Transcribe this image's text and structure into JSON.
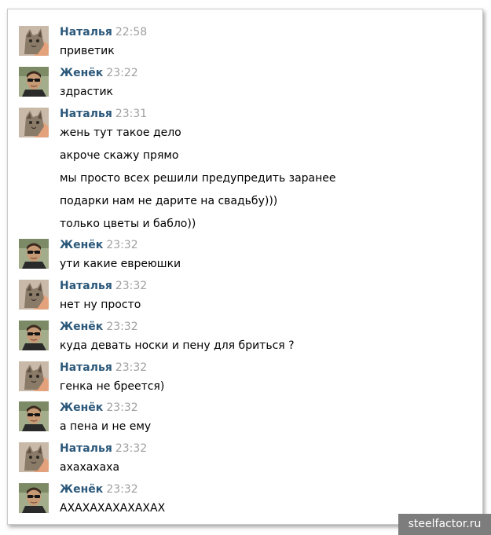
{
  "colors": {
    "author": "#2b587a",
    "time": "#a0a0a0",
    "text": "#000000"
  },
  "messages": [
    {
      "author": "Наталья",
      "time": "22:58",
      "avatar": "cat-avatar",
      "lines": [
        "приветик"
      ]
    },
    {
      "author": "Женёк",
      "time": "23:22",
      "avatar": "man-sunglasses-avatar",
      "lines": [
        "здрастик"
      ]
    },
    {
      "author": "Наталья",
      "time": "23:31",
      "avatar": "cat-avatar",
      "lines": [
        "жень тут такое дело",
        "акроче скажу прямо",
        "мы просто всех решили предупредить заранее",
        "подарки нам не дарите на свадьбу)))",
        "только цветы и бабло))"
      ]
    },
    {
      "author": "Женёк",
      "time": "23:32",
      "avatar": "man-sunglasses-avatar",
      "lines": [
        "ути какие евреюшки"
      ]
    },
    {
      "author": "Наталья",
      "time": "23:32",
      "avatar": "cat-avatar",
      "lines": [
        "нет ну просто"
      ]
    },
    {
      "author": "Женёк",
      "time": "23:32",
      "avatar": "man-sunglasses-avatar",
      "lines": [
        "куда девать носки и пену для бриться ?"
      ]
    },
    {
      "author": "Наталья",
      "time": "23:32",
      "avatar": "cat-avatar",
      "lines": [
        "генка не бреется)"
      ]
    },
    {
      "author": "Женёк",
      "time": "23:32",
      "avatar": "man-sunglasses-avatar",
      "lines": [
        "а пена и не ему"
      ]
    },
    {
      "author": "Наталья",
      "time": "23:32",
      "avatar": "cat-avatar",
      "lines": [
        "ахахахаха"
      ]
    },
    {
      "author": "Женёк",
      "time": "23:32",
      "avatar": "man-sunglasses-avatar",
      "lines": [
        "АХАХАХАХАХАХАХ"
      ]
    }
  ],
  "watermark": "steelfactor.ru"
}
